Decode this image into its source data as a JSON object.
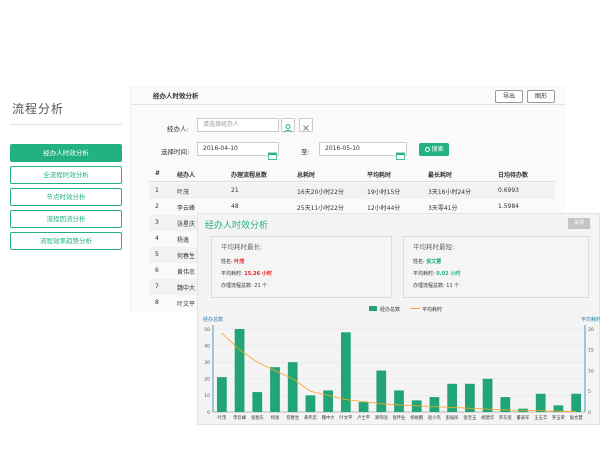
{
  "sidebar": {
    "title": "流程分析",
    "items": [
      {
        "label": "经办人时效分析",
        "active": true
      },
      {
        "label": "全流程时效分析",
        "active": false
      },
      {
        "label": "节点时效分析",
        "active": false
      },
      {
        "label": "流程因流分析",
        "active": false
      },
      {
        "label": "流程效率趋势分析",
        "active": false
      }
    ]
  },
  "panel": {
    "title": "经办人时效分析",
    "export_label": "导出",
    "chart_label": "图形",
    "handler_label": "经办人:",
    "handler_placeholder": "请选择经办人",
    "time_label": "选择时间:",
    "date_from": "2016-04-10",
    "to_label": "至:",
    "date_to": "2016-05-10",
    "search_label": "搜索"
  },
  "table": {
    "headers": [
      "#",
      "经办人",
      "办理流程总数",
      "总耗时",
      "平均耗时",
      "最长耗时",
      "日均待办数"
    ],
    "rows": [
      [
        "1",
        "叶茂",
        "21",
        "16天20小时22分",
        "19小时15分",
        "3天16小时24分",
        "0.6993"
      ],
      [
        "2",
        "李云峰",
        "48",
        "25天11小时22分",
        "12小时44分",
        "3天零41分",
        "1.5984"
      ],
      [
        "3",
        "张星庆",
        "",
        "",
        "",
        "",
        ""
      ],
      [
        "4",
        "杨逸",
        "",
        "",
        "",
        "",
        ""
      ],
      [
        "5",
        "何春生",
        "",
        "",
        "",
        "",
        ""
      ],
      [
        "6",
        "黄伟忠",
        "",
        "",
        "",
        "",
        ""
      ],
      [
        "7",
        "魏中大",
        "",
        "",
        "",
        "",
        ""
      ],
      [
        "8",
        "叶文平",
        "",
        "",
        "",
        "",
        ""
      ]
    ]
  },
  "popup": {
    "title": "经办人时效分析",
    "close_label": "关闭",
    "longest": {
      "title": "平均耗时最长:",
      "name_label": "姓名:",
      "name": "叶茂",
      "avg_label": "平均耗时:",
      "avg": "15.26 小时",
      "total_label": "办理流程总数:",
      "total": "21 个"
    },
    "shortest": {
      "title": "平均耗时最短:",
      "name_label": "姓名:",
      "name": "侯文慧",
      "avg_label": "平均耗时:",
      "avg": "0.02 小时",
      "total_label": "办理流程总数:",
      "total": "11 个"
    }
  },
  "chart_data": {
    "type": "bar",
    "categories": [
      "叶茂",
      "李云峰",
      "张星庆",
      "杨逸",
      "何春生",
      "黄伟忠",
      "魏中大",
      "叶文平",
      "卢士平",
      "郑伟国",
      "张怀业",
      "杨裕鹏",
      "赵小杰",
      "彭振民",
      "张宝玉",
      "胡建华",
      "罗东宽",
      "董表军",
      "王玉丰",
      "罗玉荣",
      "侯文慧"
    ],
    "series": [
      {
        "name": "经办总数",
        "type": "bar",
        "axis": "left",
        "color": "#22a477",
        "values": [
          21,
          50,
          12,
          27,
          30,
          10,
          13,
          48,
          6,
          25,
          13,
          7,
          9,
          17,
          17,
          20,
          9,
          2,
          11,
          4,
          11
        ]
      },
      {
        "name": "平均耗时",
        "type": "line",
        "axis": "right",
        "color": "#f5a623",
        "values": [
          19,
          15,
          12,
          10,
          8,
          5,
          4,
          3,
          2.5,
          2,
          1.7,
          1.5,
          1.3,
          1.1,
          0.9,
          0.7,
          0.5,
          0.4,
          0.3,
          0.2,
          0.1
        ]
      }
    ],
    "ylabel_left": "经办总数",
    "ylabel_right": "平均耗时",
    "ylim_left": [
      0,
      50
    ],
    "ylim_right": [
      0,
      20
    ],
    "yticks_left": [
      "0",
      "10",
      "20",
      "30",
      "40",
      "50"
    ],
    "yticks_right": [
      "0",
      "5",
      "10",
      "15",
      "20"
    ],
    "legend_position": "top-center",
    "grid": true
  }
}
